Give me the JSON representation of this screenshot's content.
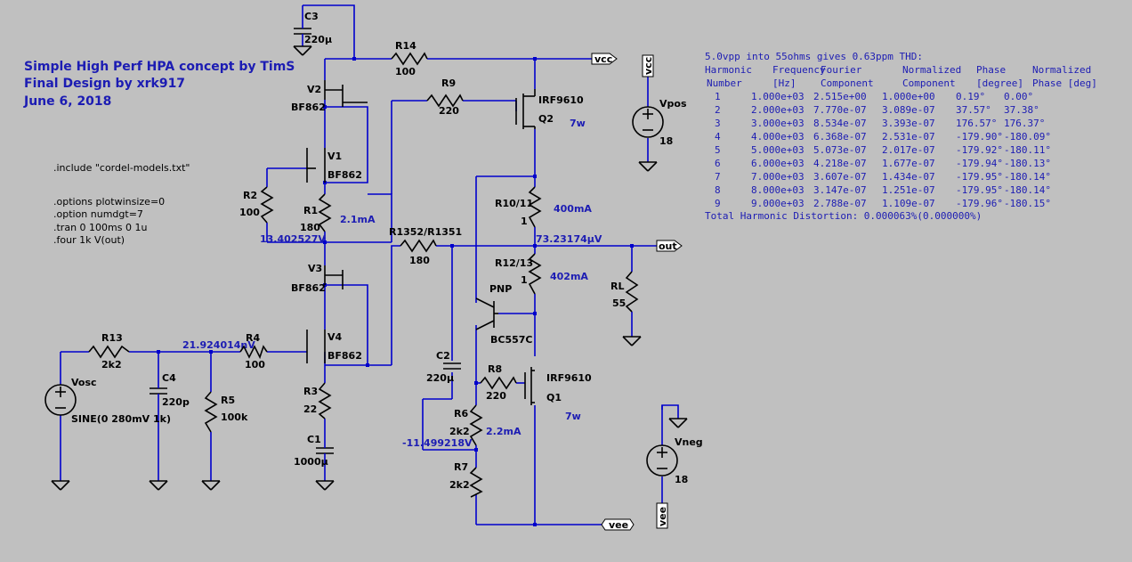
{
  "title_lines": [
    "Simple High Perf HPA concept by TimS",
    "Final Design by xrk917",
    "June 6, 2018"
  ],
  "directives": [
    ".include \"cordel-models.txt\"",
    ".options plotwinsize=0",
    ".option numdgt=7",
    ".tran 0 100ms 0 1u",
    ".four 1k V(out)"
  ],
  "components": {
    "C3": {
      "name": "C3",
      "value": "220µ"
    },
    "R14": {
      "name": "R14",
      "value": "100"
    },
    "R9": {
      "name": "R9",
      "value": "220"
    },
    "V2": {
      "name": "V2",
      "value": "BF862"
    },
    "V1": {
      "name": "V1",
      "value": "BF862"
    },
    "Q2": {
      "name": "Q2",
      "value": "IRF9610"
    },
    "R2": {
      "name": "R2",
      "value": "100"
    },
    "R1": {
      "name": "R1",
      "value": "180"
    },
    "R10": {
      "name": "R10/11",
      "value": "1"
    },
    "R1352": {
      "name": "R1352/R1351",
      "value": "180"
    },
    "R12": {
      "name": "R12/13",
      "value": "1"
    },
    "V3": {
      "name": "V3",
      "value": "BF862"
    },
    "V4": {
      "name": "V4",
      "value": "BF862"
    },
    "PNP": {
      "name": "PNP",
      "value": "BC557C"
    },
    "RL": {
      "name": "RL",
      "value": "55"
    },
    "R13": {
      "name": "R13",
      "value": "2k2"
    },
    "R4": {
      "name": "R4",
      "value": "100"
    },
    "C4": {
      "name": "C4",
      "value": "220p"
    },
    "R5": {
      "name": "R5",
      "value": "100k"
    },
    "Vosc": {
      "name": "Vosc",
      "value": "SINE(0 280mV 1k)"
    },
    "R3": {
      "name": "R3",
      "value": "22"
    },
    "C1": {
      "name": "C1",
      "value": "1000µ"
    },
    "C2": {
      "name": "C2",
      "value": "220µ"
    },
    "R8": {
      "name": "R8",
      "value": "220"
    },
    "Q1": {
      "name": "Q1",
      "value": "IRF9610"
    },
    "R6": {
      "name": "R6",
      "value": "2k2"
    },
    "R7": {
      "name": "R7",
      "value": "2k2"
    },
    "Vpos": {
      "name": "Vpos",
      "value": "18"
    },
    "Vneg": {
      "name": "Vneg",
      "value": "18"
    }
  },
  "labels": {
    "q2_power": "7w",
    "q1_power": "7w",
    "i_400": "400mA",
    "i_402": "402mA",
    "i_21": "2.1mA",
    "i_22": "2.2mA",
    "v_node1": "13.402527V",
    "v_out": "73.23174µV",
    "v_in": "21.924014nV",
    "v_node2": "-11.499218V"
  },
  "nets": {
    "vcc": "vcc",
    "out": "out",
    "vee": "vee",
    "vcc_src": "vcc",
    "vee_src": "vee"
  },
  "thd": {
    "heading": "5.0vpp into 55ohms gives 0.63ppm THD:",
    "header1": [
      "Harmonic",
      "Frequency",
      "Fourier",
      "Normalized",
      "Phase",
      "Normalized"
    ],
    "header2": [
      "Number",
      "[Hz]",
      "Component",
      "Component",
      "[degree]",
      "Phase [deg]"
    ],
    "rows": [
      [
        "1",
        "1.000e+03",
        "2.515e+00",
        "1.000e+00",
        "0.19°",
        "0.00°"
      ],
      [
        "2",
        "2.000e+03",
        "7.770e-07",
        "3.089e-07",
        "37.57°",
        "37.38°"
      ],
      [
        "3",
        "3.000e+03",
        "8.534e-07",
        "3.393e-07",
        "176.57°",
        "176.37°"
      ],
      [
        "4",
        "4.000e+03",
        "6.368e-07",
        "2.531e-07",
        "-179.90°",
        "-180.09°"
      ],
      [
        "5",
        "5.000e+03",
        "5.073e-07",
        "2.017e-07",
        "-179.92°",
        "-180.11°"
      ],
      [
        "6",
        "6.000e+03",
        "4.218e-07",
        "1.677e-07",
        "-179.94°",
        "-180.13°"
      ],
      [
        "7",
        "7.000e+03",
        "3.607e-07",
        "1.434e-07",
        "-179.95°",
        "-180.14°"
      ],
      [
        "8",
        "8.000e+03",
        "3.147e-07",
        "1.251e-07",
        "-179.95°",
        "-180.14°"
      ],
      [
        "9",
        "9.000e+03",
        "2.788e-07",
        "1.109e-07",
        "-179.96°",
        "-180.15°"
      ]
    ],
    "total": "Total Harmonic Distortion: 0.000063%(0.000000%)"
  },
  "colors": {
    "background": "#c0c0c0",
    "wire": "#0000cc",
    "annotation": "#1c1cb3"
  }
}
